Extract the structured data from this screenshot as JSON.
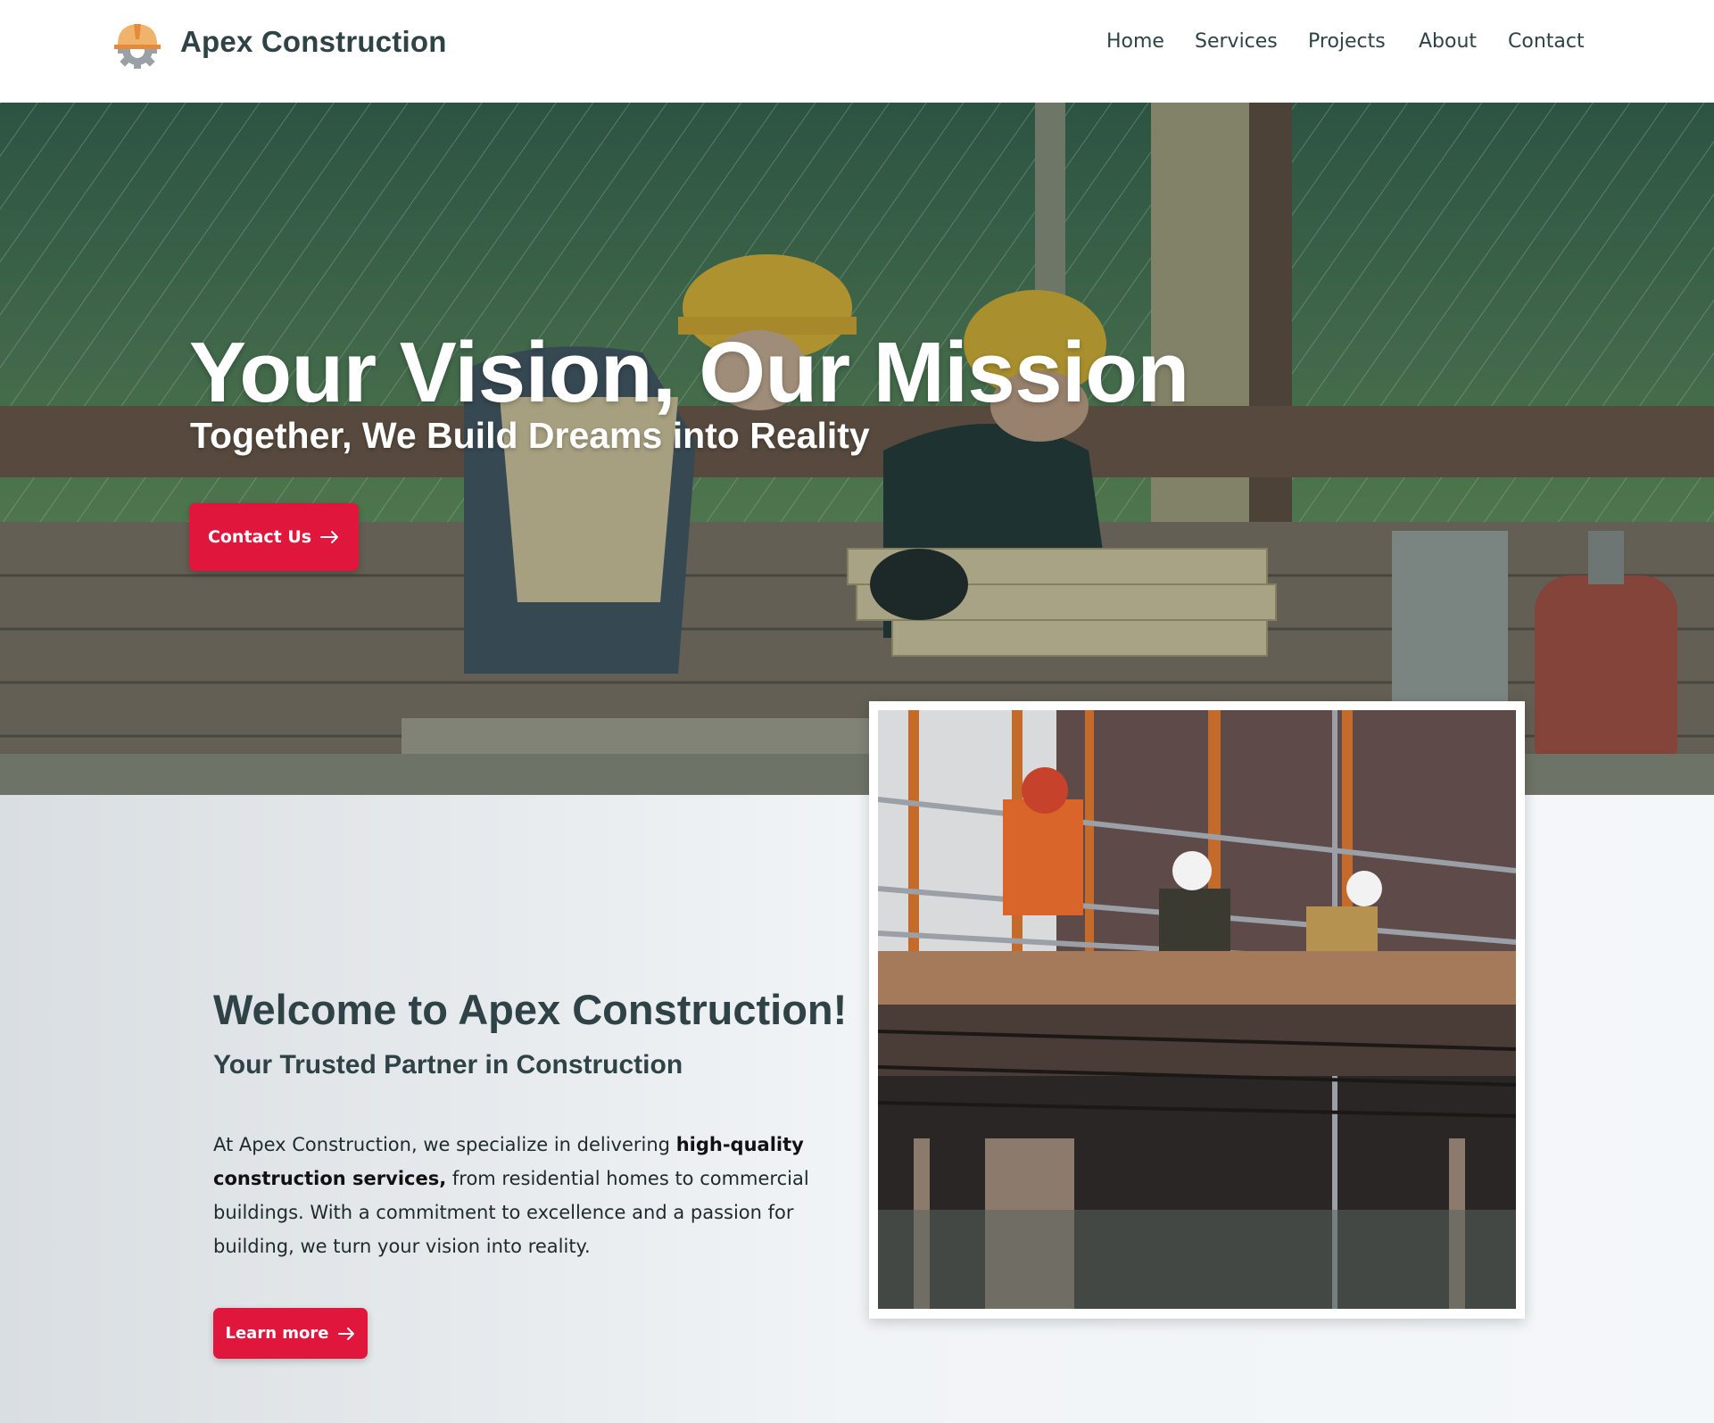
{
  "header": {
    "brand": "Apex Construction",
    "logo_icon": "hardhat-gear-icon",
    "nav": [
      {
        "label": "Home"
      },
      {
        "label": "Services"
      },
      {
        "label": "Projects"
      },
      {
        "label": "About"
      },
      {
        "label": "Contact"
      }
    ]
  },
  "hero": {
    "title": "Your Vision, Our Mission",
    "subtitle": "Together, We Build Dreams into Reality",
    "cta_label": "Contact Us",
    "cta_icon": "arrow-right-icon"
  },
  "welcome": {
    "title": "Welcome to Apex Construction!",
    "subtitle": "Your Trusted Partner in Construction",
    "body_1": "At Apex Construction, we specialize in delivering ",
    "body_bold": "high-quality construction services,",
    "body_2": " from residential homes to commercial buildings. With a commitment to excellence and a passion for building, we turn your vision into reality.",
    "cta_label": "Learn more",
    "cta_icon": "arrow-right-icon"
  },
  "colors": {
    "accent": "#e0163c",
    "text_dark": "#2f4246",
    "header_bg": "#ffffff"
  }
}
